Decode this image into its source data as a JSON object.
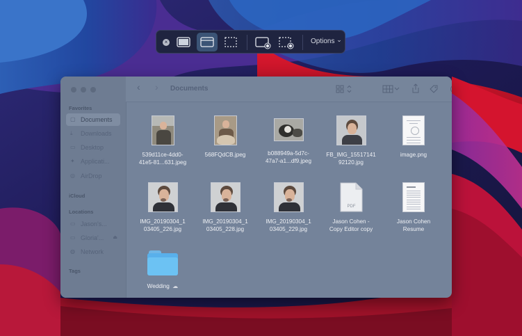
{
  "toolbar": {
    "close_icon": "×",
    "options_label": "Options",
    "options_chevron": "⌄",
    "modes": [
      {
        "name": "capture-entire-screen",
        "icon": "screen-icon"
      },
      {
        "name": "capture-selected-window",
        "icon": "window-icon",
        "active": true
      },
      {
        "name": "capture-selected-portion",
        "icon": "dashed-rect-icon"
      },
      {
        "name": "record-entire-screen",
        "icon": "screen-record-icon"
      },
      {
        "name": "record-selected-portion",
        "icon": "dashed-record-icon"
      }
    ]
  },
  "finder": {
    "title": "Documents",
    "back": "‹",
    "forward": "›",
    "sidebar": {
      "favorites_label": "Favorites",
      "items": [
        {
          "label": "Documents",
          "icon": "▢",
          "selected": true
        },
        {
          "label": "Downloads",
          "icon": "⤓"
        },
        {
          "label": "Desktop",
          "icon": "▭"
        },
        {
          "label": "Applicati...",
          "icon": "✦"
        },
        {
          "label": "AirDrop",
          "icon": "◎"
        }
      ],
      "icloud_label": "iCloud",
      "locations_label": "Locations",
      "locations": [
        {
          "label": "Jason's...",
          "icon": "▭"
        },
        {
          "label": "Gloria'...",
          "icon": "▭",
          "eject": "⏏"
        },
        {
          "label": "Network",
          "icon": "◍"
        }
      ],
      "tags_label": "Tags"
    },
    "files": [
      {
        "line1": "539d11ce-4dd0-",
        "line2": "41e5-81...631.jpeg",
        "kind": "photo-man"
      },
      {
        "line1": "568FQdCB.jpeg",
        "line2": "",
        "kind": "photo-dog"
      },
      {
        "line1": "b088949a-5d7c-",
        "line2": "47a7-a1...df9.jpeg",
        "kind": "photo-cat"
      },
      {
        "line1": "FB_IMG_15517141",
        "line2": "92120.jpg",
        "kind": "photo-portrait"
      },
      {
        "line1": "image.png",
        "line2": "",
        "kind": "document"
      },
      {
        "line1": "IMG_20190304_1",
        "line2": "03405_226.jpg",
        "kind": "photo-portrait"
      },
      {
        "line1": "IMG_20190304_1",
        "line2": "03405_228.jpg",
        "kind": "photo-portrait"
      },
      {
        "line1": "IMG_20190304_1",
        "line2": "03405_229.jpg",
        "kind": "photo-portrait"
      },
      {
        "line1": "Jason Cohen -",
        "line2": "Copy Editor copy",
        "kind": "pdf",
        "badge": "PDF"
      },
      {
        "line1": "Jason Cohen",
        "line2": "Resume",
        "kind": "document"
      },
      {
        "line1": "Wedding",
        "line2": "",
        "kind": "folder",
        "cloud": "☁"
      }
    ]
  },
  "colors": {
    "wallpaper_red": "#c8102e",
    "wallpaper_blue": "#2a5db0",
    "wallpaper_purple": "#6a2a9c",
    "finder_overlay": "#74839a",
    "toolbar_bg": "#1f2440",
    "toolbar_active": "#3b5476",
    "folder_blue": "#59b0eb"
  }
}
